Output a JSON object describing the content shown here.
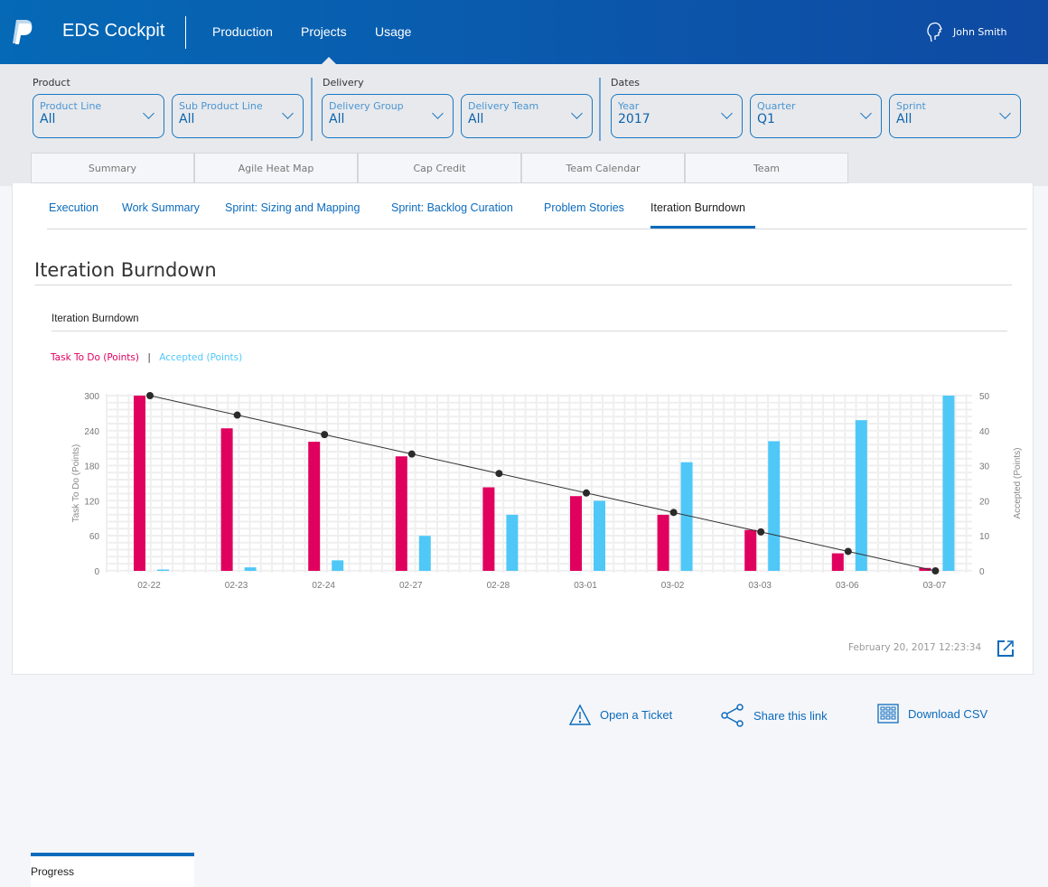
{
  "header": {
    "app_title": "EDS Cockpit",
    "nav": [
      "Production",
      "Projects",
      "Usage"
    ],
    "active_nav": "Projects",
    "user": "John Smith"
  },
  "filters": {
    "groups": [
      "Product",
      "Delivery",
      "Dates"
    ],
    "selects": [
      {
        "label": "Product Line",
        "value": "All"
      },
      {
        "label": "Sub Product Line",
        "value": "All"
      },
      {
        "label": "Delivery Group",
        "value": "All"
      },
      {
        "label": "Delivery Team",
        "value": "All"
      },
      {
        "label": "Year",
        "value": "2017"
      },
      {
        "label": "Quarter",
        "value": "Q1"
      },
      {
        "label": "Sprint",
        "value": "All"
      }
    ]
  },
  "tabs": [
    "Summary",
    "Progress",
    "Agile Heat Map",
    "Cap Credit",
    "Team Calendar",
    "Team"
  ],
  "active_tab": "Progress",
  "subtabs": [
    "Execution",
    "Work Summary",
    "Sprint: Sizing and Mapping",
    "Sprint: Backlog Curation",
    "Problem Stories",
    "Iteration Burndown"
  ],
  "active_subtab": "Iteration Burndown",
  "page_title": "Iteration Burndown",
  "chart_title": "Iteration Burndown",
  "legend": {
    "todo": "Task To Do (Points)",
    "sep": "|",
    "accepted": "Accepted (Points)"
  },
  "timestamp": "February 20, 2017 12:23:34",
  "actions": {
    "ticket": "Open a Ticket",
    "share": "Share this link",
    "csv": "Download CSV"
  },
  "colors": {
    "todo": "#e0005e",
    "accepted": "#4fc8f8",
    "ideal": "#333333",
    "brand": "#0b6bbd"
  },
  "chart_data": {
    "type": "bar",
    "categories": [
      "02-22",
      "02-23",
      "02-24",
      "02-27",
      "02-28",
      "03-01",
      "03-02",
      "03-03",
      "03-06",
      "03-07"
    ],
    "ylabel": "Task To Do (Points)",
    "y2label": "Accepted (Points)",
    "ylim": [
      0,
      300
    ],
    "yticks": [
      0,
      60,
      120,
      180,
      240,
      300
    ],
    "y2lim": [
      0,
      50
    ],
    "y2ticks": [
      0,
      10,
      20,
      30,
      40,
      50
    ],
    "grid": true,
    "legend_position": "top-left",
    "series": [
      {
        "name": "Task To Do (Points)",
        "axis": "left",
        "type": "bar",
        "values": [
          300,
          244,
          221,
          196,
          143,
          128,
          96,
          70,
          30,
          5
        ]
      },
      {
        "name": "Accepted (Points)",
        "axis": "right",
        "type": "bar",
        "values": [
          0.3,
          1,
          3,
          10,
          16,
          20,
          31,
          37,
          43,
          50
        ]
      },
      {
        "axis": "left",
        "type": "line",
        "values": [
          300,
          266.7,
          233.3,
          200,
          166.7,
          133.3,
          100,
          66.7,
          33.3,
          0
        ]
      }
    ]
  }
}
